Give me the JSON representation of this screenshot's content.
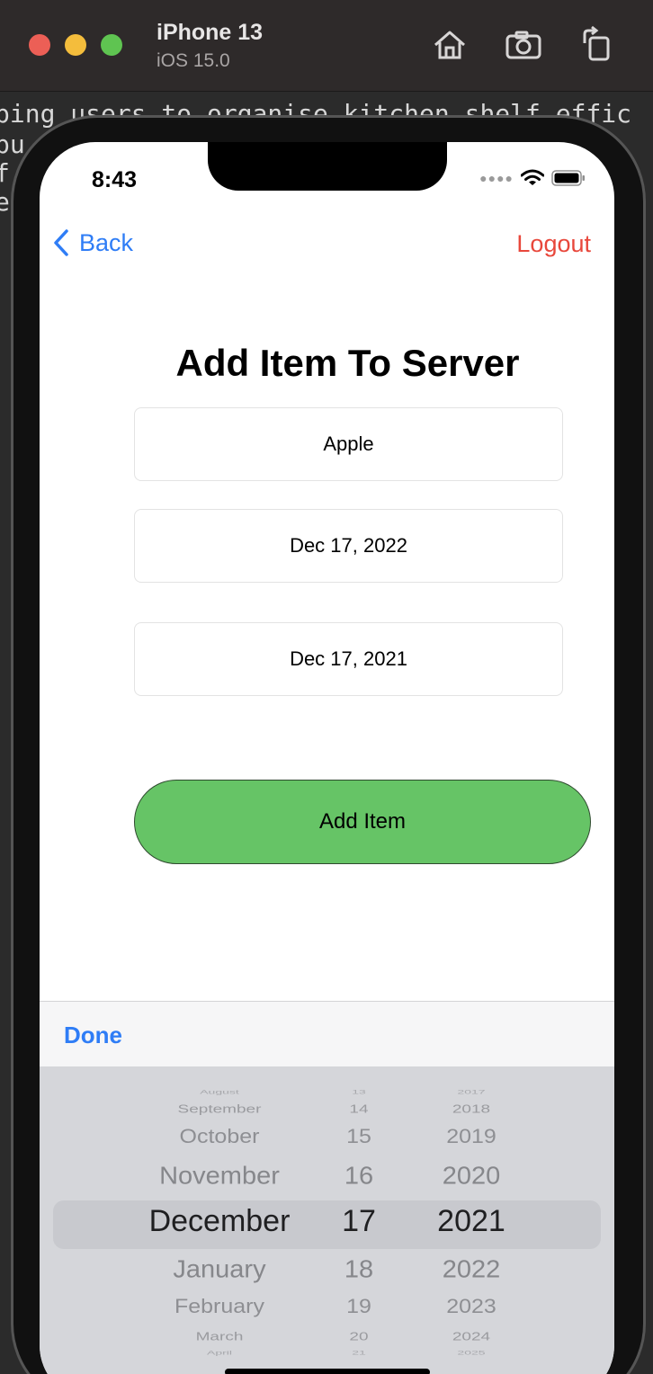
{
  "simulator": {
    "device_name": "iPhone 13",
    "os_version": "iOS 15.0",
    "buttons": [
      "home-icon",
      "screenshot-icon",
      "rotate-icon"
    ]
  },
  "editor_background": {
    "lines": [
      "ping users to organise kitchen shelf effic",
      " pu",
      "                                          f",
      "en"
    ]
  },
  "status_bar": {
    "time": "8:43"
  },
  "nav": {
    "back_label": "Back",
    "logout_label": "Logout"
  },
  "form": {
    "title": "Add Item To Server",
    "item_name": "Apple",
    "expiry_date": "Dec 17, 2022",
    "purchase_date": "Dec 17, 2021",
    "submit_label": "Add Item"
  },
  "keyboard_toolbar": {
    "done_label": "Done"
  },
  "date_picker": {
    "months": [
      "August",
      "September",
      "October",
      "November",
      "December",
      "January",
      "February",
      "March",
      "April"
    ],
    "days": [
      "13",
      "14",
      "15",
      "16",
      "17",
      "18",
      "19",
      "20",
      "21"
    ],
    "years": [
      "2017",
      "2018",
      "2019",
      "2020",
      "2021",
      "2022",
      "2023",
      "2024",
      "2025"
    ],
    "selected": {
      "month": "December",
      "day": "17",
      "year": "2021"
    }
  },
  "colors": {
    "accent_blue": "#2f7df6",
    "logout_red": "#e8473b",
    "button_green": "#66c466"
  }
}
